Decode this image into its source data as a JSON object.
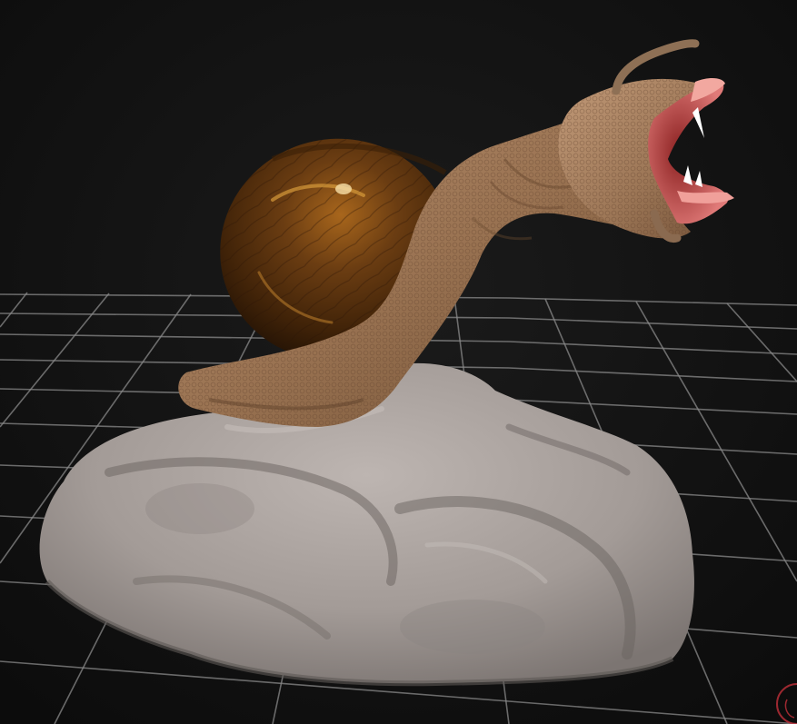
{
  "viewport": {
    "background_color": "#141414",
    "grid_color": "#8a8a8a"
  },
  "scene": {
    "objects": [
      {
        "name": "snail-creature",
        "shell_color": "#5a3410",
        "body_color": "#a07a55",
        "mouth_color": "#e07a78"
      },
      {
        "name": "rock-base",
        "color": "#a8a09c"
      }
    ]
  },
  "overlay": {
    "corner_icon": "axis-gizmo-icon",
    "corner_icon_color": "#c0303a"
  }
}
